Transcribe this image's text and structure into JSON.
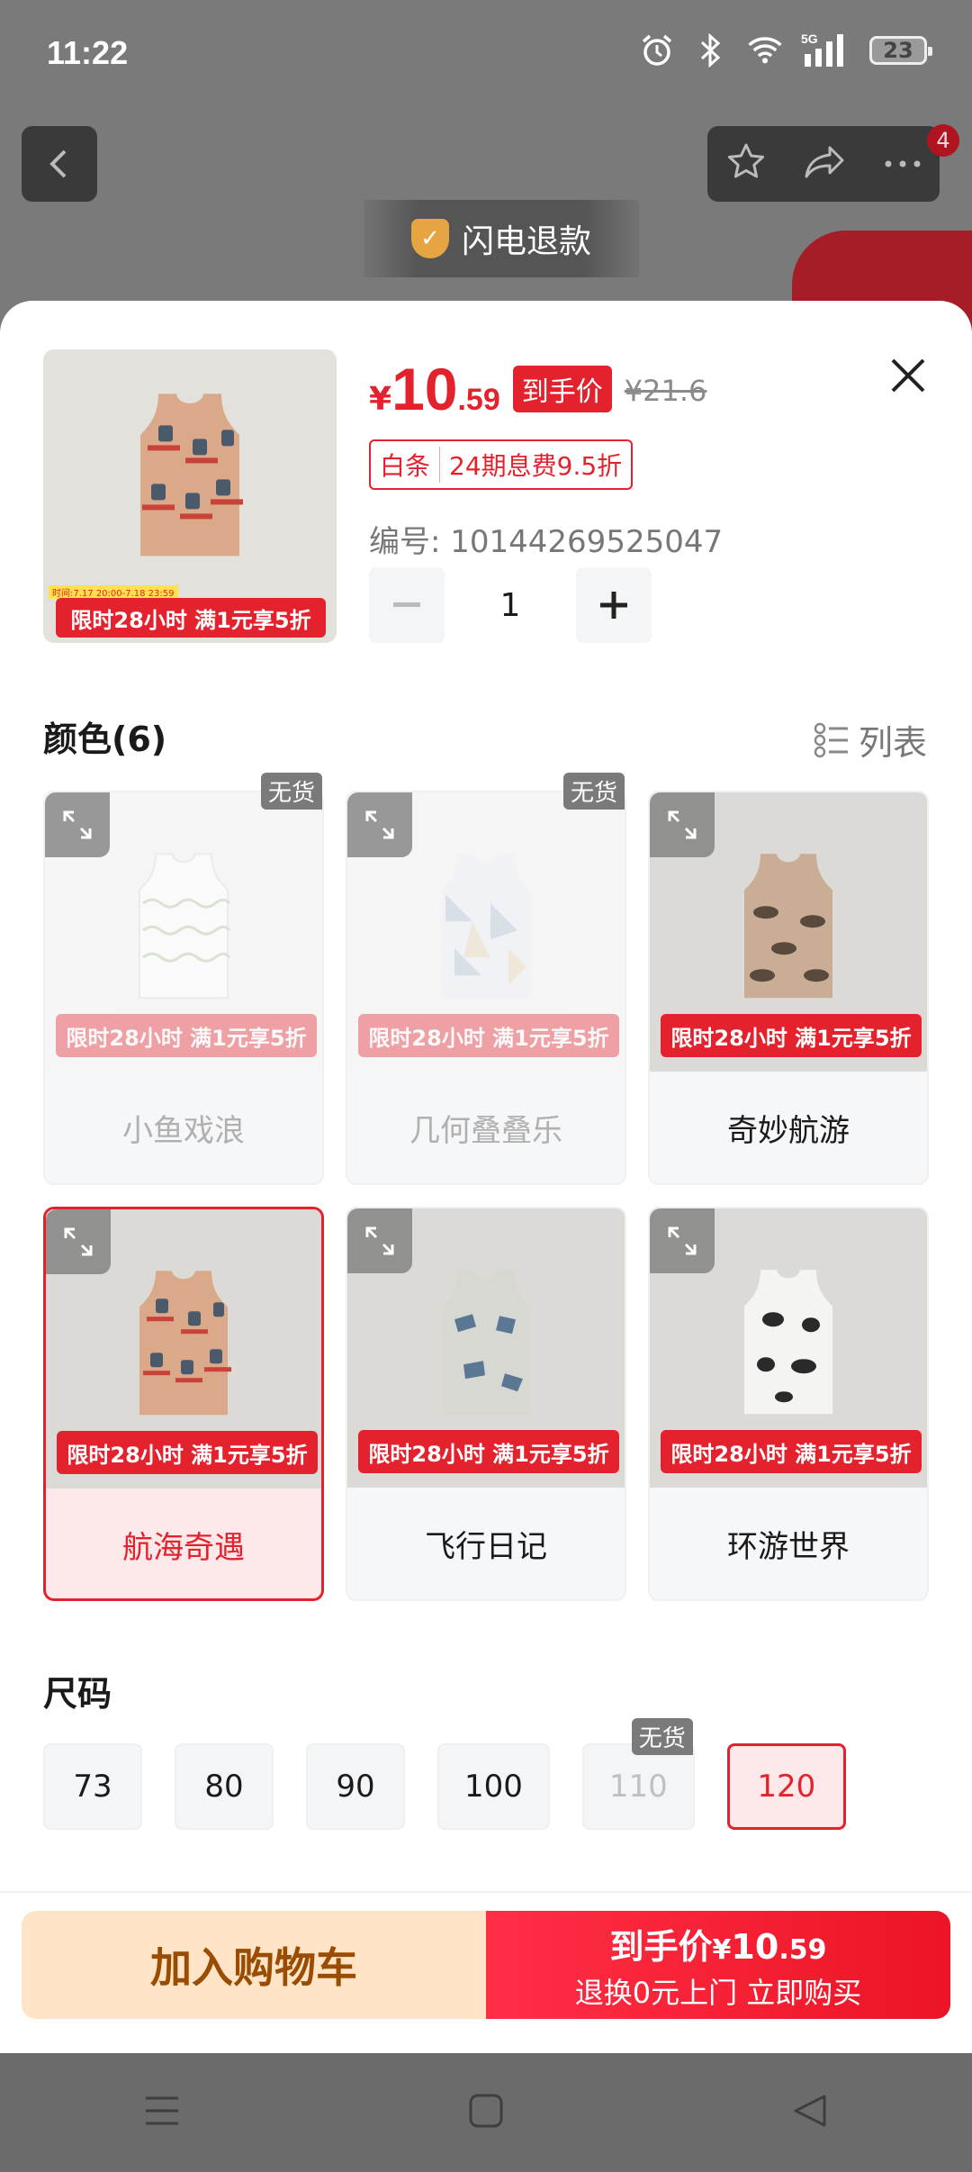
{
  "status_bar": {
    "time": "11:22",
    "battery": "23",
    "network": "5G"
  },
  "background": {
    "refund_label": "闪电退款",
    "cart_badge": "4"
  },
  "product": {
    "currency": "¥",
    "price_int": "10",
    "price_dec": ".59",
    "price_tag": "到手价",
    "original_price": "¥21.6",
    "baitiao_label": "白条",
    "baitiao_detail": "24期息费9.5折",
    "sku": "编号: 10144269525047",
    "quantity": "1"
  },
  "promo_text": "限时28小时 满1元享5折",
  "promo_small": "时间:7.17 20:00-7.18 23:59",
  "colors": {
    "title": "颜色(6)",
    "list_label": "列表",
    "no_stock": "无货",
    "items": [
      {
        "label": "小鱼戏浪",
        "available": false,
        "selected": false
      },
      {
        "label": "几何叠叠乐",
        "available": false,
        "selected": false
      },
      {
        "label": "奇妙航游",
        "available": true,
        "selected": false
      },
      {
        "label": "航海奇遇",
        "available": true,
        "selected": true
      },
      {
        "label": "飞行日记",
        "available": true,
        "selected": false
      },
      {
        "label": "环游世界",
        "available": true,
        "selected": false
      }
    ]
  },
  "sizes": {
    "title": "尺码",
    "items": [
      {
        "label": "73",
        "available": true,
        "selected": false
      },
      {
        "label": "80",
        "available": true,
        "selected": false
      },
      {
        "label": "90",
        "available": true,
        "selected": false
      },
      {
        "label": "100",
        "available": true,
        "selected": false
      },
      {
        "label": "110",
        "available": false,
        "selected": false
      },
      {
        "label": "120",
        "available": true,
        "selected": true
      }
    ]
  },
  "actions": {
    "add_to_cart": "加入购物车",
    "buy_prefix": "到手价",
    "buy_currency": "¥",
    "buy_price_int": "10",
    "buy_price_dec": ".59",
    "buy_sub": "退换0元上门 立即购买"
  },
  "colors_theme": {
    "accent": "#e4222d",
    "cart_bg": "#ffe4c8",
    "cart_text": "#9a4d00"
  }
}
